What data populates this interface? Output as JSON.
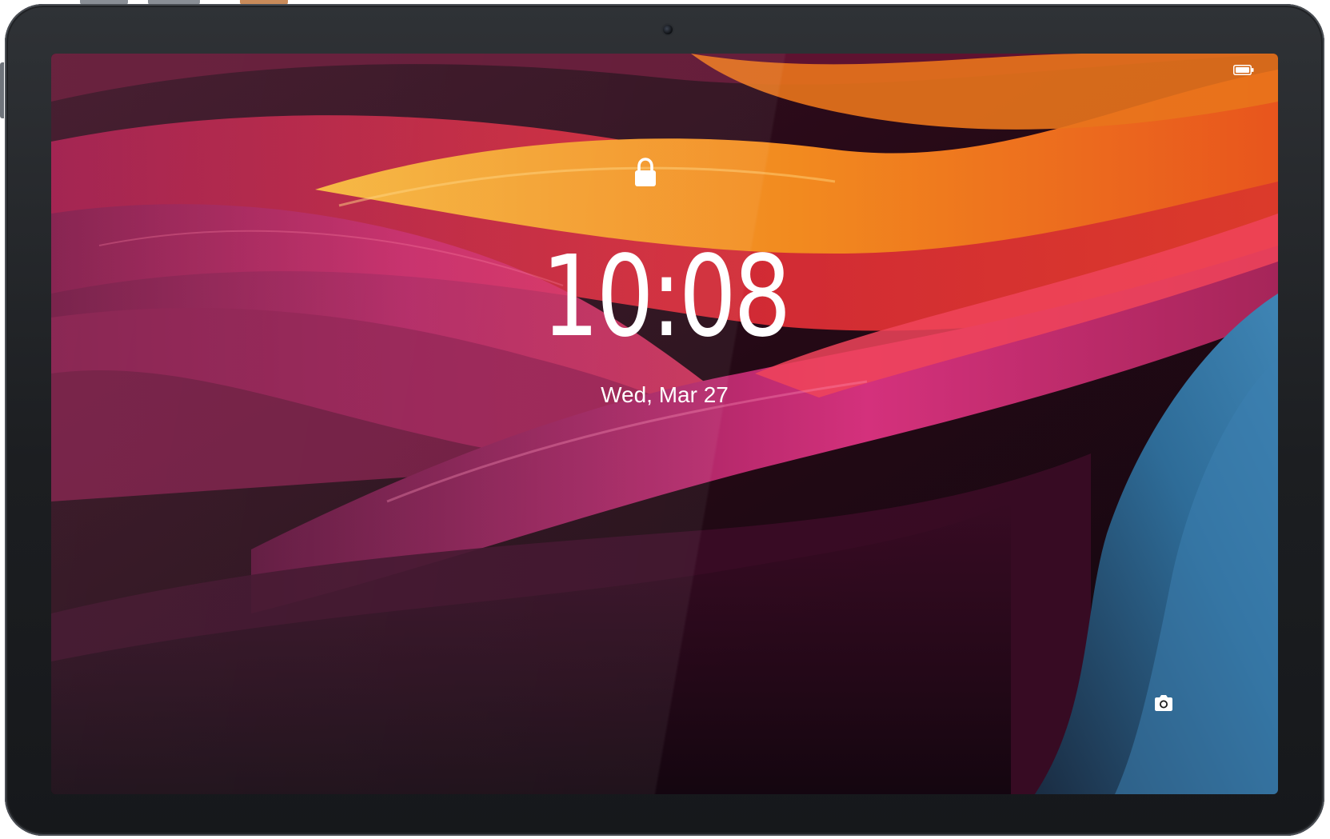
{
  "lock_screen": {
    "time": "10:08",
    "date": "Wed, Mar 27"
  },
  "status_bar": {
    "battery_icon": "battery-icon"
  },
  "icons": {
    "lock": "lock-icon",
    "camera_shortcut": "camera-icon",
    "front_camera": "front-camera-lens"
  },
  "colors": {
    "bezel": "#1c1e21",
    "wallpaper_orange": "#f39a1c",
    "wallpaper_red": "#d81f3a",
    "wallpaper_magenta": "#b8216b",
    "wallpaper_blue": "#2f6f9c",
    "text": "#ffffff"
  }
}
